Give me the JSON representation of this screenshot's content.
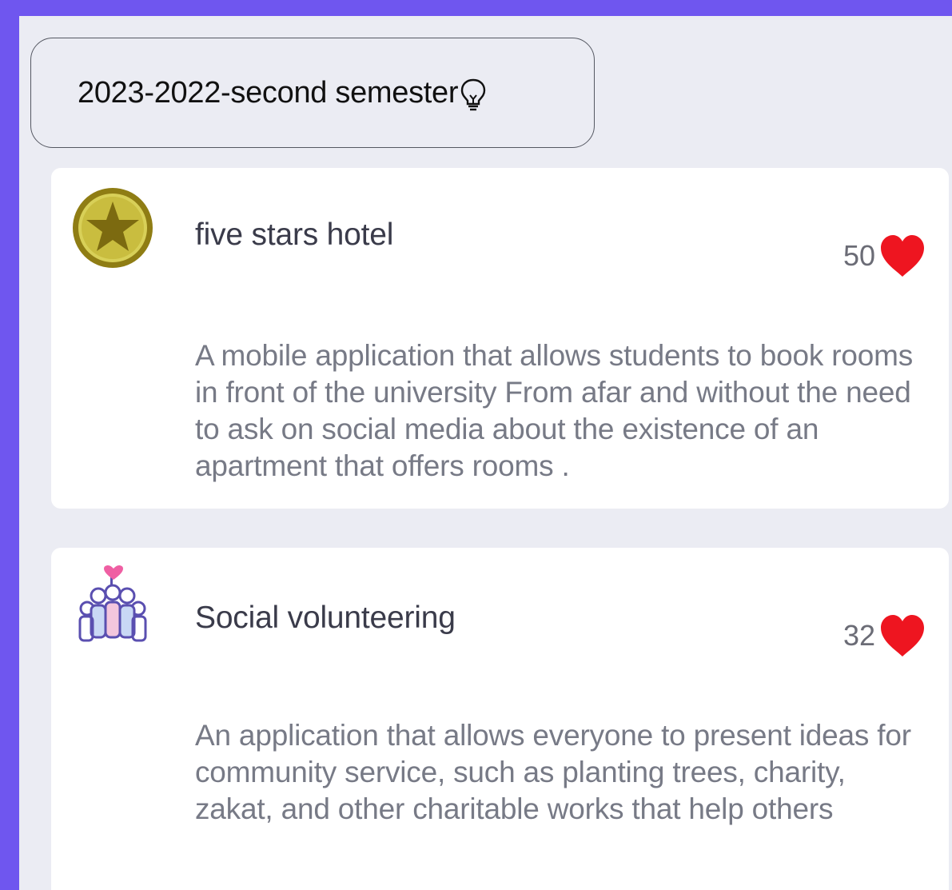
{
  "semester": {
    "label": "2023-2022-second semester",
    "icon": "lightbulb-icon"
  },
  "projects": [
    {
      "title": "five stars hotel",
      "likes": "50",
      "description": "A mobile application that allows students to book rooms in front of the university From afar and without the need to ask on social media about the existence of an apartment that offers rooms .",
      "avatar_icon": "gold-star-badge-icon",
      "like_icon": "heart-icon"
    },
    {
      "title": "Social volunteering",
      "likes": "32",
      "description": "An application that allows everyone to present ideas for community service, such as planting trees, charity, zakat, and other charitable works that help others",
      "avatar_icon": "volunteers-group-icon",
      "like_icon": "heart-icon"
    }
  ],
  "colors": {
    "frame": "#6f56ef",
    "background": "#ebecf3",
    "card": "#ffffff",
    "heart": "#ee1520",
    "star_badge": "#c9bd3f"
  }
}
